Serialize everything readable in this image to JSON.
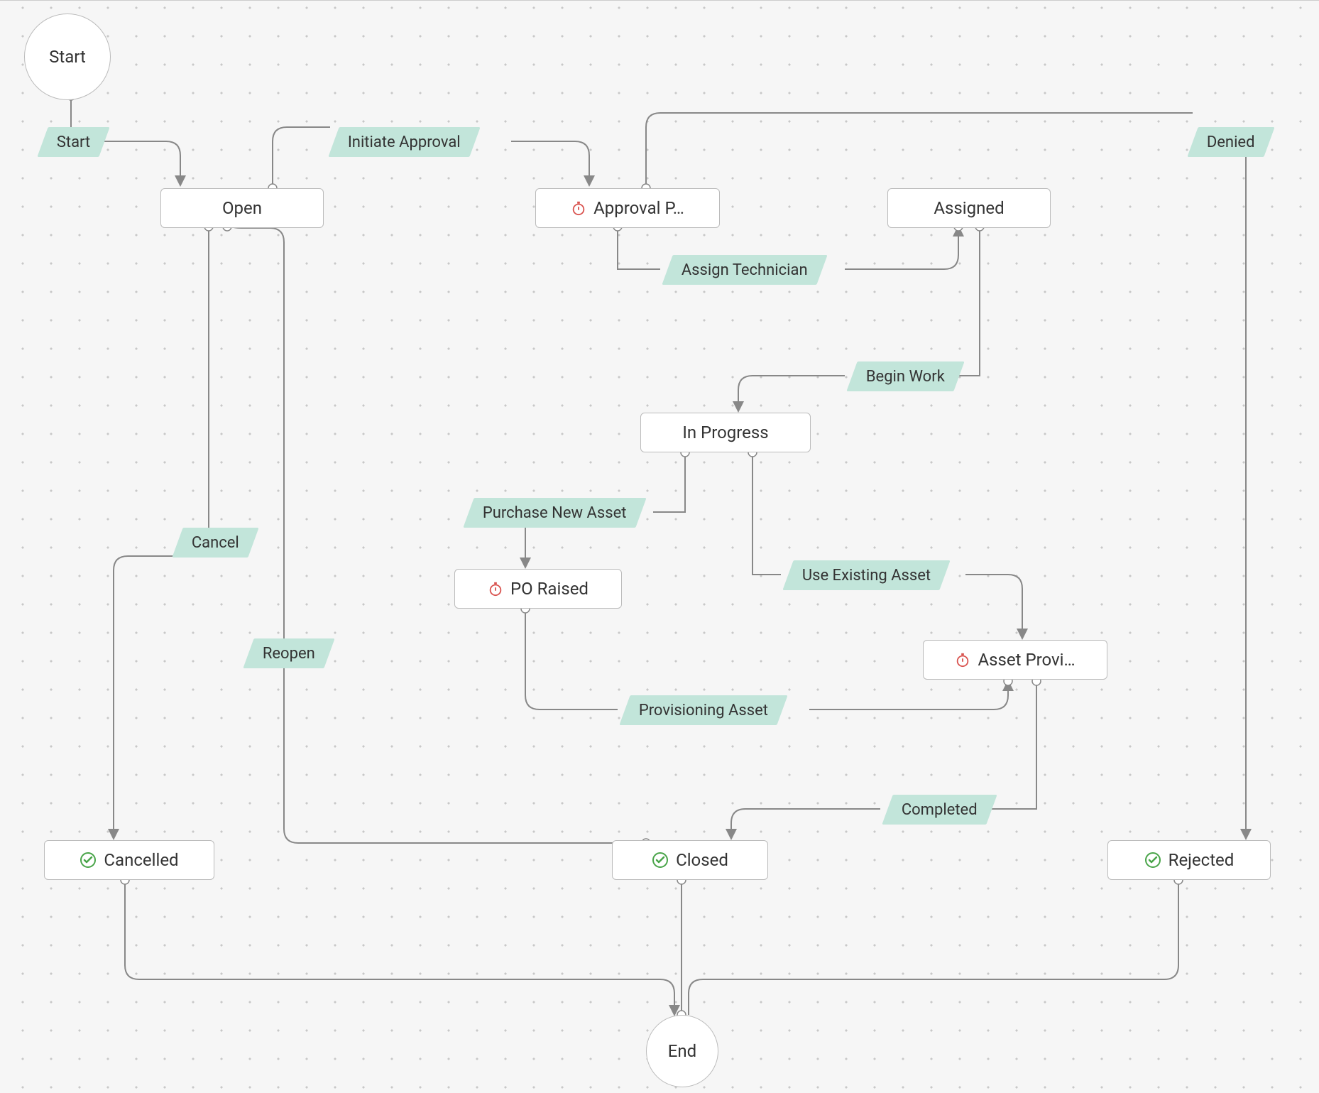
{
  "nodes": {
    "start": {
      "label": "Start"
    },
    "open": {
      "label": "Open"
    },
    "approval": {
      "label": "Approval P…"
    },
    "assigned": {
      "label": "Assigned"
    },
    "inprogress": {
      "label": "In Progress"
    },
    "poraised": {
      "label": "PO Raised"
    },
    "assetprov": {
      "label": "Asset Provi…"
    },
    "closed": {
      "label": "Closed"
    },
    "cancelled": {
      "label": "Cancelled"
    },
    "rejected": {
      "label": "Rejected"
    },
    "end": {
      "label": "End"
    }
  },
  "transitions": {
    "t_start": {
      "label": "Start"
    },
    "t_initiate": {
      "label": "Initiate Approval"
    },
    "t_denied": {
      "label": "Denied"
    },
    "t_assigntech": {
      "label": "Assign Technician"
    },
    "t_beginwork": {
      "label": "Begin Work"
    },
    "t_cancel": {
      "label": "Cancel"
    },
    "t_reopen": {
      "label": "Reopen"
    },
    "t_purchase": {
      "label": "Purchase New Asset"
    },
    "t_useexist": {
      "label": "Use Existing Asset"
    },
    "t_provasset": {
      "label": "Provisioning Asset"
    },
    "t_completed": {
      "label": "Completed"
    }
  },
  "colors": {
    "transition_bg": "#c2e5da",
    "edge": "#888",
    "check": "#48a448",
    "stopwatch": "#d9534f"
  }
}
